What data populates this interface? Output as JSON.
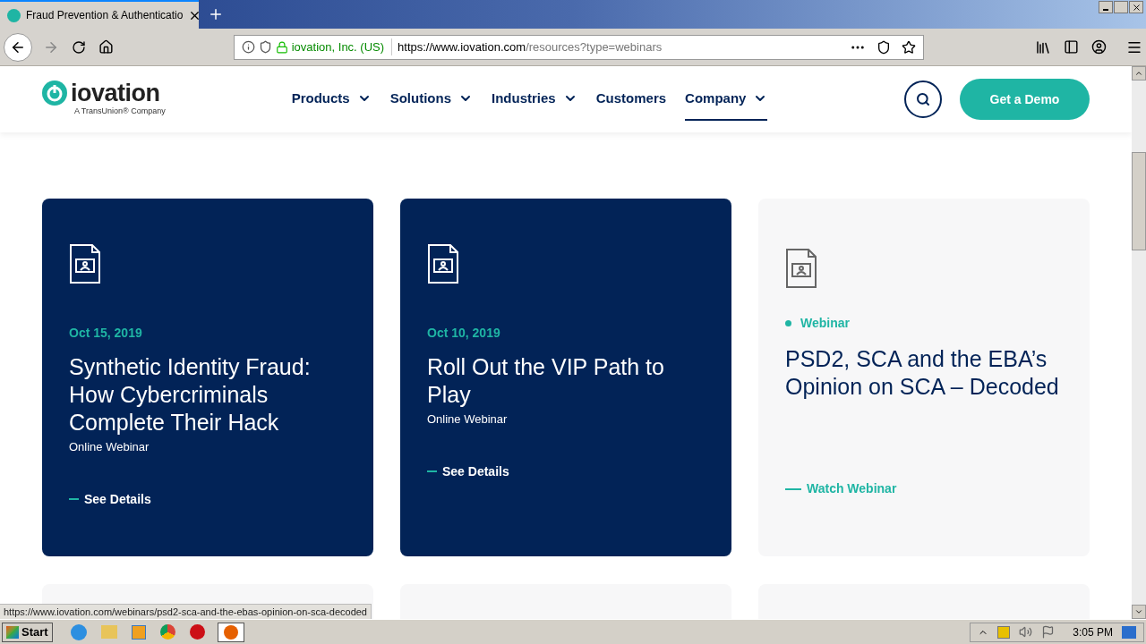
{
  "browser": {
    "tab_title": "Fraud Prevention & Authenticatio",
    "identity": "iovation, Inc. (US)",
    "url_host": "https://www.iovation.com",
    "url_path": "/resources?type=webinars",
    "status_url": "https://www.iovation.com/webinars/psd2-sca-and-the-ebas-opinion-on-sca-decoded"
  },
  "site": {
    "logo_word": "iovation",
    "logo_tagline": "A TransUnion® Company",
    "nav": [
      {
        "label": "Products",
        "dropdown": true,
        "selected": false
      },
      {
        "label": "Solutions",
        "dropdown": true,
        "selected": false
      },
      {
        "label": "Industries",
        "dropdown": true,
        "selected": false
      },
      {
        "label": "Customers",
        "dropdown": false,
        "selected": false
      },
      {
        "label": "Company",
        "dropdown": true,
        "selected": true
      }
    ],
    "demo_button": "Get a Demo"
  },
  "cards": [
    {
      "kind": "dark",
      "date": "Oct 15, 2019",
      "title": "Synthetic Identity Fraud: How Cybercriminals Complete Their Hack",
      "subtitle": "Online Webinar",
      "link": "See Details"
    },
    {
      "kind": "dark",
      "date": "Oct 10, 2019",
      "title": "Roll Out the VIP Path to Play",
      "subtitle": "Online Webinar",
      "link": "See Details"
    },
    {
      "kind": "light",
      "category": "Webinar",
      "title": "PSD2, SCA and the EBA’s Opinion on SCA – Decoded",
      "link": "Watch Webinar"
    }
  ],
  "taskbar": {
    "start": "Start",
    "clock": "3:05 PM"
  }
}
